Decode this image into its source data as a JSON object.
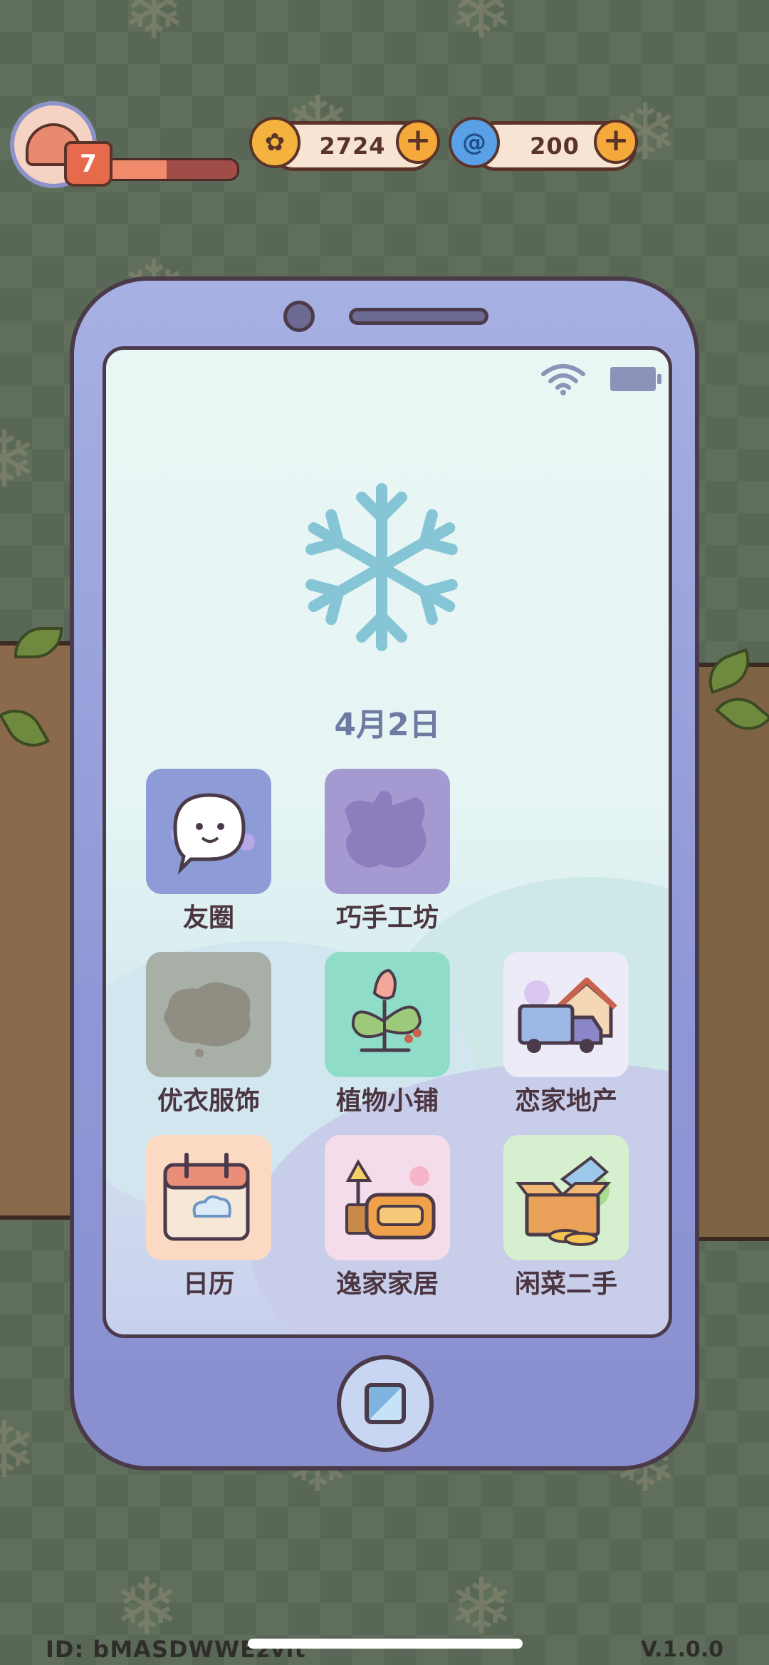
{
  "hud": {
    "level": "7",
    "xp_progress": 0.48,
    "coins": "2724",
    "gems": "200"
  },
  "phone": {
    "date": "4月2日",
    "apps": [
      {
        "label": "友圈",
        "icon": "chat-bubble-icon",
        "locked": false
      },
      {
        "label": "巧手工坊",
        "icon": "workshop-icon",
        "locked": true
      },
      {
        "label": "优衣服饰",
        "icon": "clothing-icon",
        "locked": true
      },
      {
        "label": "植物小铺",
        "icon": "plant-icon",
        "locked": false
      },
      {
        "label": "恋家地产",
        "icon": "moving-truck-icon",
        "locked": false
      },
      {
        "label": "日历",
        "icon": "calendar-icon",
        "locked": false
      },
      {
        "label": "逸家家居",
        "icon": "furniture-icon",
        "locked": false
      },
      {
        "label": "闲菜二手",
        "icon": "secondhand-box-icon",
        "locked": false
      }
    ]
  },
  "footer": {
    "id": "ID:  bMASDWWEzvit",
    "version": "V.1.0.0"
  },
  "colors": {
    "background": "#5f6f5b",
    "phone_body": "#9aa2dc",
    "outline": "#4b3b4a",
    "accent_orange": "#f6a93b",
    "text_dark": "#4b3540"
  }
}
